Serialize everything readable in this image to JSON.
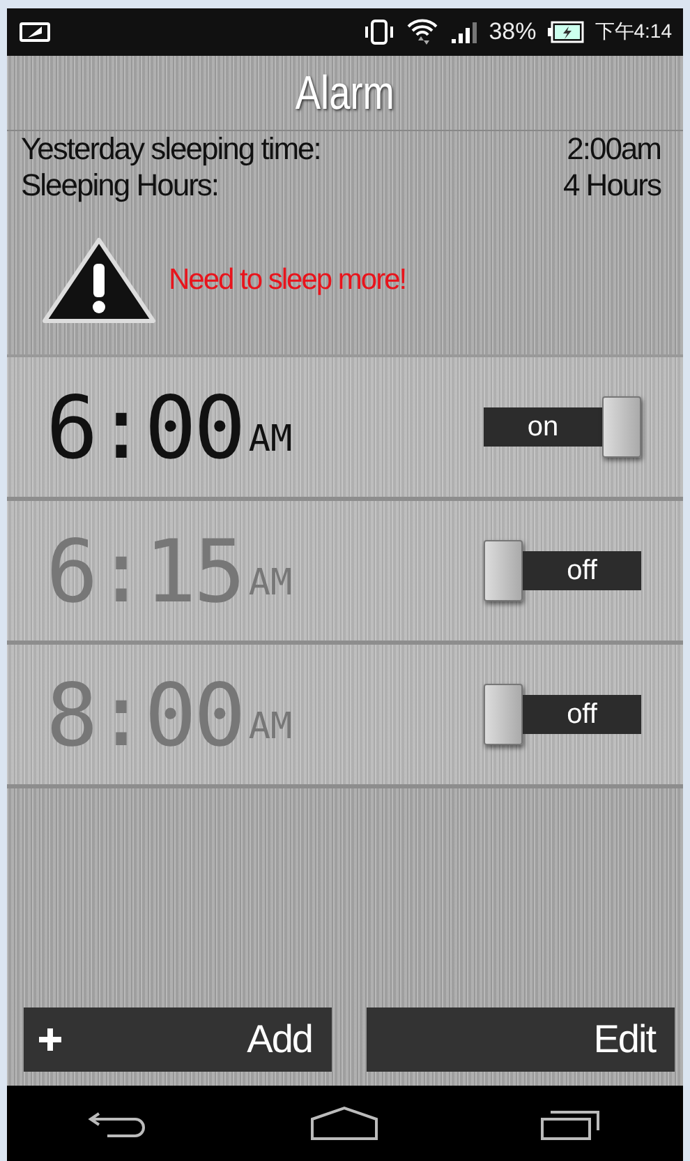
{
  "status_bar": {
    "battery_percent": "38%",
    "time": "下午4:14"
  },
  "title": "Alarm",
  "info": [
    {
      "label": "Yesterday sleeping time:",
      "value": "2:00am"
    },
    {
      "label": "Sleeping Hours:",
      "value": "4 Hours"
    }
  ],
  "warning": "Need to sleep more!",
  "alarms": [
    {
      "time": "6:00",
      "period": "AM",
      "on": true,
      "toggle_label": "on"
    },
    {
      "time": "6:15",
      "period": "AM",
      "on": false,
      "toggle_label": "off"
    },
    {
      "time": "8:00",
      "period": "AM",
      "on": false,
      "toggle_label": "off"
    }
  ],
  "buttons": [
    {
      "kind": "add",
      "label": "Add"
    },
    {
      "kind": "edit",
      "label": "Edit"
    }
  ]
}
